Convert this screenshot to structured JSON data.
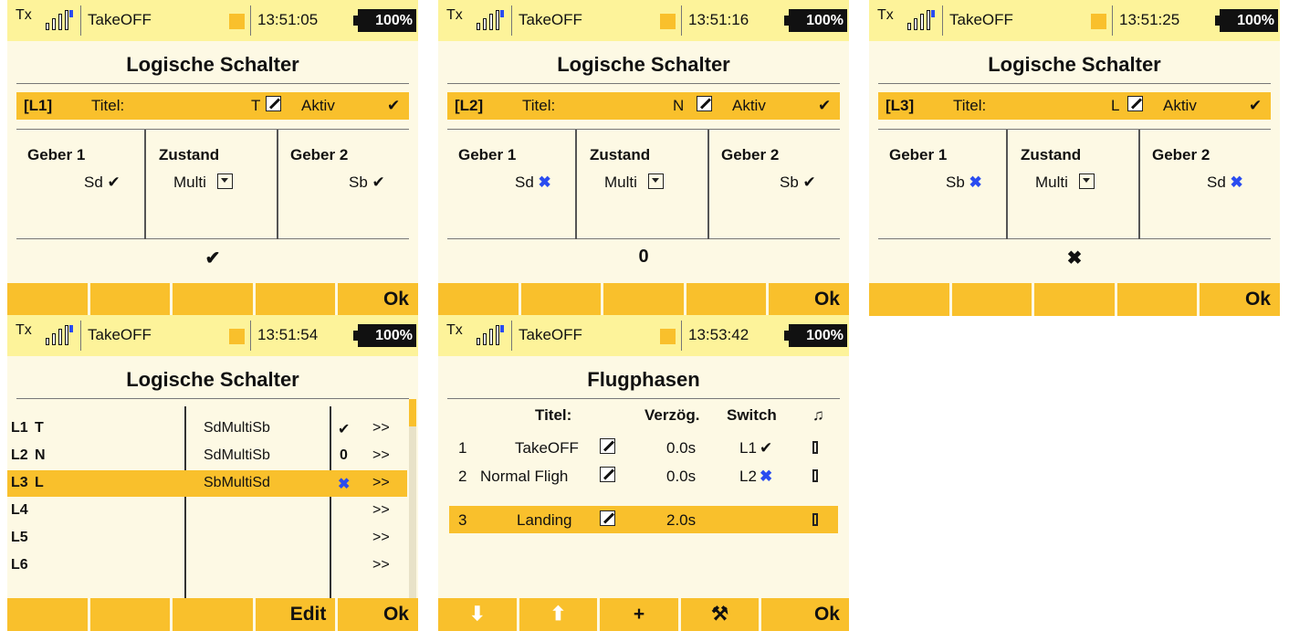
{
  "status_bars": [
    {
      "tx": "Tx",
      "model": "TakeOFF",
      "time": "13:51:05",
      "battery": "100%"
    },
    {
      "tx": "Tx",
      "model": "TakeOFF",
      "time": "13:51:16",
      "battery": "100%"
    },
    {
      "tx": "Tx",
      "model": "TakeOFF",
      "time": "13:51:25",
      "battery": "100%"
    },
    {
      "tx": "Tx",
      "model": "TakeOFF",
      "time": "13:51:54",
      "battery": "100%"
    },
    {
      "tx": "Tx",
      "model": "TakeOFF",
      "time": "13:53:42",
      "battery": "100%"
    }
  ],
  "screens": {
    "s1": {
      "title": "Logische Schalter",
      "id": "[L1]",
      "titel_label": "Titel:",
      "titel_value": "T",
      "aktiv": "Aktiv",
      "aktiv_mark": "✔",
      "geber1_head": "Geber 1",
      "geber1_val": "Sd",
      "geber1_mark": "✔",
      "zustand_head": "Zustand",
      "zustand_val": "Multi",
      "geber2_head": "Geber 2",
      "geber2_val": "Sb",
      "geber2_mark": "✔",
      "result": "✔",
      "ok": "Ok"
    },
    "s2": {
      "title": "Logische Schalter",
      "id": "[L2]",
      "titel_label": "Titel:",
      "titel_value": "N",
      "aktiv": "Aktiv",
      "aktiv_mark": "✔",
      "geber1_head": "Geber 1",
      "geber1_val": "Sd",
      "geber1_mark": "✖",
      "zustand_head": "Zustand",
      "zustand_val": "Multi",
      "geber2_head": "Geber 2",
      "geber2_val": "Sb",
      "geber2_mark": "✔",
      "result": "0",
      "ok": "Ok"
    },
    "s3": {
      "title": "Logische Schalter",
      "id": "[L3]",
      "titel_label": "Titel:",
      "titel_value": "L",
      "aktiv": "Aktiv",
      "aktiv_mark": "✔",
      "geber1_head": "Geber 1",
      "geber1_val": "Sb",
      "geber1_mark": "✖",
      "zustand_head": "Zustand",
      "zustand_val": "Multi",
      "geber2_head": "Geber 2",
      "geber2_val": "Sd",
      "geber2_mark": "✖",
      "result": "✖",
      "ok": "Ok"
    },
    "s4": {
      "title": "Logische Schalter",
      "rows": [
        {
          "id": "L1",
          "name": "T",
          "expr": "SdMultiSb",
          "state": "✔",
          "more": ">>"
        },
        {
          "id": "L2",
          "name": "N",
          "expr": "SdMultiSb",
          "state": "0",
          "more": ">>"
        },
        {
          "id": "L3",
          "name": "L",
          "expr": "SbMultiSd",
          "state": "✖",
          "more": ">>"
        },
        {
          "id": "L4",
          "name": "",
          "expr": "",
          "state": "",
          "more": ">>"
        },
        {
          "id": "L5",
          "name": "",
          "expr": "",
          "state": "",
          "more": ">>"
        },
        {
          "id": "L6",
          "name": "",
          "expr": "",
          "state": "",
          "more": ">>"
        }
      ],
      "edit": "Edit",
      "ok": "Ok"
    },
    "s5": {
      "title": "Flugphasen",
      "col_titel": "Titel:",
      "col_delay": "Verzög.",
      "col_switch": "Switch",
      "col_sound": "♫",
      "rows": [
        {
          "num": "1",
          "name": "TakeOFF",
          "delay": "0.0s",
          "switch": "L1",
          "mark": "✔"
        },
        {
          "num": "2",
          "name": "Normal Fligh",
          "delay": "0.0s",
          "switch": "L2",
          "mark": "✖"
        },
        {
          "num": "3",
          "name": "Landing",
          "delay": "2.0s",
          "switch": "",
          "mark": ""
        }
      ],
      "down": "⬇",
      "up": "⬆",
      "add": "+",
      "tools": "⚒",
      "ok": "Ok"
    }
  }
}
